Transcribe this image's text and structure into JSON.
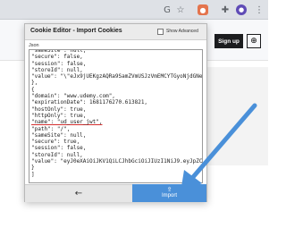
{
  "browser": {
    "toolbar_icons": [
      "translate-icon",
      "star-icon",
      "cookie-editor-extension-icon",
      "extensions-icon",
      "profile-icon",
      "menu-icon"
    ]
  },
  "page": {
    "signup_label": "Sign up"
  },
  "popup": {
    "title": "Cookie Editor - Import Cookies",
    "show_advanced_label": "Show Advanced",
    "show_advanced_checked": false,
    "json_label": "Json",
    "json_lines": [
      "\"sameSite\": null,",
      "\"secure\": false,",
      "\"session\": false,",
      "\"storeId\": null,",
      "\"value\": \"\\\"eJx9jUEKgzAQRa9SamZVmUSJzVmEMCYTGyoNjdGNePcf6kmPX",
      "},",
      "{",
      "\"domain\": \"www.udemy.com\",",
      "\"expirationDate\": 1681176270.613821,",
      "\"hostOnly\": true,",
      "\"httpOnly\": true,",
      "\"name\": \"ud_user_jwt\",",
      "\"path\": \"/\",",
      "\"sameSite\": null,",
      "\"secure\": true,",
      "\"session\": false,",
      "\"storeId\": null,",
      "\"value\": \"eyJ0eXAiOiJKV1QiLCJhbGciOiJIUzI1NiJ9.eyJpZCI6MjA",
      "}",
      "]"
    ],
    "back_label": "←",
    "import_icon": "⇪",
    "import_label": "Import"
  },
  "colors": {
    "import_button": "#4a90d9",
    "arrow": "#4a90d9"
  }
}
